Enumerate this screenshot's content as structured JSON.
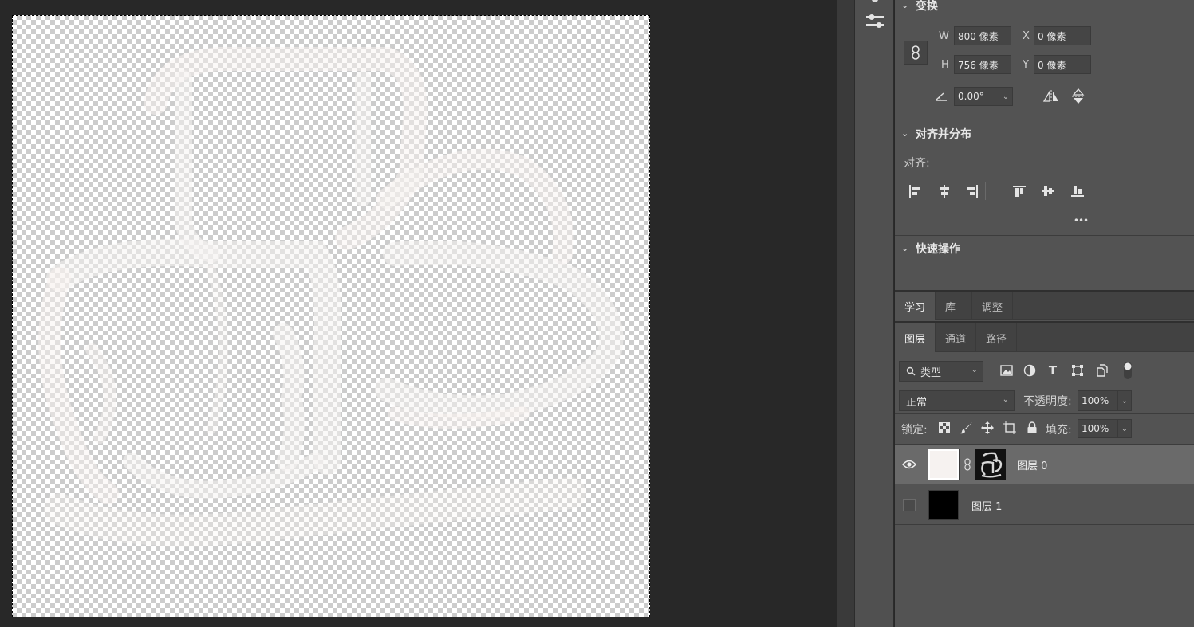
{
  "transform": {
    "title": "变换",
    "w_label": "W",
    "w_value": "800 像素",
    "h_label": "H",
    "h_value": "756 像素",
    "x_label": "X",
    "x_value": "0 像素",
    "y_label": "Y",
    "y_value": "0 像素",
    "angle_value": "0.00°"
  },
  "align": {
    "title": "对齐并分布",
    "label": "对齐:",
    "more": "•••"
  },
  "quick_actions": {
    "title": "快速操作"
  },
  "top_tabs": [
    "学习",
    "库",
    "调整"
  ],
  "layer_tabs": [
    "图层",
    "通道",
    "路径"
  ],
  "layers_panel": {
    "filter_kind": "类型",
    "blend_mode": "正常",
    "opacity_label": "不透明度:",
    "opacity_value": "100%",
    "lock_label": "锁定:",
    "fill_label": "填充:",
    "fill_value": "100%"
  },
  "layers": [
    {
      "name": "图层 0",
      "visible": true,
      "selected": true
    },
    {
      "name": "图层 1",
      "visible": false,
      "selected": false
    }
  ],
  "colors": {
    "panel_bg": "#535353",
    "workspace_bg": "#282828",
    "selected_row": "#6a6a6a"
  }
}
